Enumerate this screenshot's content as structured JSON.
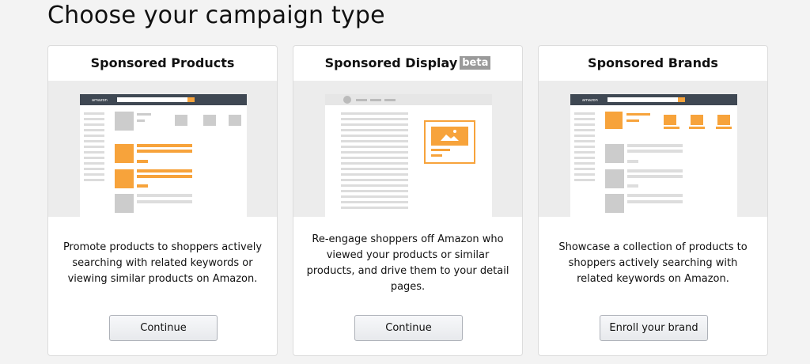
{
  "page": {
    "title": "Choose your campaign type"
  },
  "cards": [
    {
      "title": "Sponsored Products",
      "description": "Promote products to shoppers actively searching with related keywords or viewing similar products on Amazon.",
      "button": "Continue"
    },
    {
      "title": "Sponsored Display",
      "badge": "beta",
      "description": "Re-engage shoppers off Amazon who viewed your products or similar products, and drive them to your detail pages.",
      "button": "Continue"
    },
    {
      "title": "Sponsored Brands",
      "description": "Showcase a collection of products to shoppers actively searching with related keywords on Amazon.",
      "button": "Enroll your brand"
    }
  ],
  "illustration": {
    "logo_text": "amazon"
  },
  "colors": {
    "accent": "#f7a33b",
    "placeholder": "#cccccc",
    "header_bar": "#3f4853"
  }
}
